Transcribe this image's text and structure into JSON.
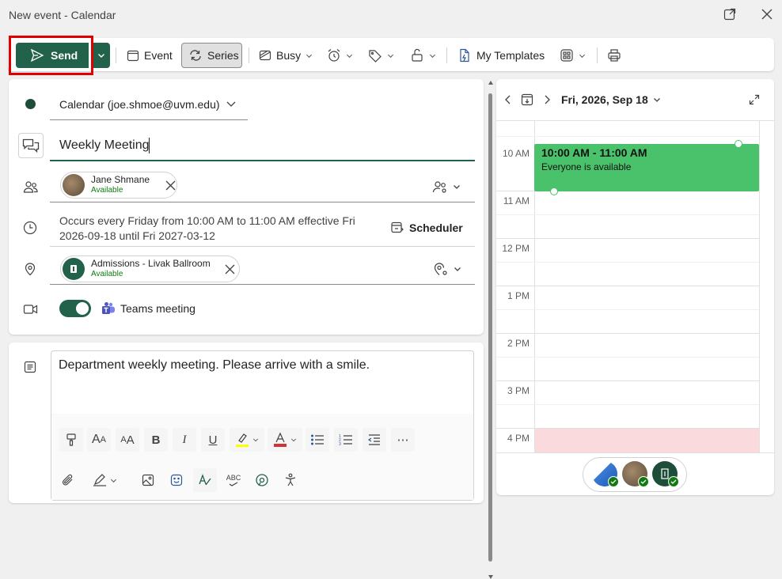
{
  "window": {
    "title": "New event - Calendar"
  },
  "toolbar": {
    "send": "Send",
    "event": "Event",
    "series": "Series",
    "busy": "Busy",
    "my_templates": "My Templates"
  },
  "form": {
    "calendar": "Calendar (joe.shmoe@uvm.edu)",
    "title_value": "Weekly Meeting",
    "attendee": {
      "name": "Jane Shmane",
      "status": "Available"
    },
    "recurrence": "Occurs every Friday from 10:00 AM to 11:00 AM effective Fri 2026-09-18 until Fri 2027-03-12",
    "scheduler": "Scheduler",
    "location": {
      "name": "Admissions - Livak Ballroom",
      "status": "Available"
    },
    "teams": "Teams meeting",
    "body": "Department weekly meeting. Please arrive with a smile."
  },
  "calendar": {
    "date": "Fri, 2026, Sep 18",
    "times": [
      "10 AM",
      "11 AM",
      "12 PM",
      "1 PM",
      "2 PM",
      "3 PM",
      "4 PM"
    ],
    "event": {
      "time": "10:00 AM - 11:00 AM",
      "note": "Everyone is available"
    }
  },
  "colors": {
    "accent": "#22614a",
    "event": "#4ac26b",
    "busy": "#fadadd",
    "highlight_outline": "#e00000"
  }
}
